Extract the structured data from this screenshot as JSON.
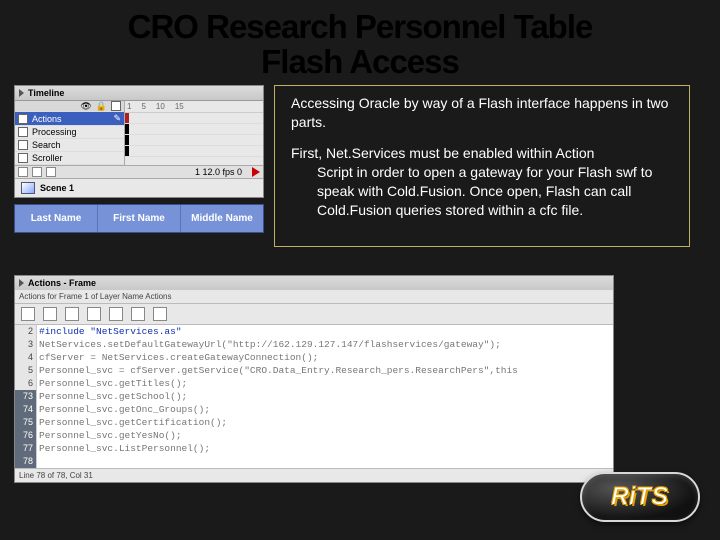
{
  "title_line1": "CRO Research Personnel Table",
  "title_line2": "Flash Access",
  "timeline": {
    "header": "Timeline",
    "ruler": [
      "1",
      "5",
      "10",
      "15"
    ],
    "layers": [
      "Actions",
      "Processing",
      "Search",
      "Scroller"
    ],
    "footer_status": "1   12.0 fps   0",
    "scene": "Scene 1"
  },
  "table_headers": [
    "Last Name",
    "First Name",
    "Middle Name"
  ],
  "body": {
    "p1": "Accessing Oracle by way of a Flash interface happens in two parts.",
    "p2a": "First, Net.Services must be enabled within Action",
    "p2b": "Script in order to open a gateway for your Flash swf to speak with Cold.Fusion. Once open, Flash can call Cold.Fusion queries stored within a cfc file."
  },
  "actions": {
    "header": "Actions - Frame",
    "sub": "Actions for Frame 1 of Layer Name Actions",
    "gutter": [
      "2",
      "3",
      "4",
      "5",
      "6",
      "73",
      "74",
      "75",
      "76",
      "77",
      "78"
    ],
    "code": [
      {
        "cls": "blue",
        "t": "#include \"NetServices.as\""
      },
      {
        "cls": "gray",
        "t": ""
      },
      {
        "cls": "gray",
        "t": "NetServices.setDefaultGatewayUrl(\"http://162.129.127.147/flashservices/gateway\");"
      },
      {
        "cls": "gray",
        "t": "cfServer = NetServices.createGatewayConnection();"
      },
      {
        "cls": "gray",
        "t": "Personnel_svc = cfServer.getService(\"CRO.Data_Entry.Research_pers.ResearchPers\",this"
      },
      {
        "cls": "gray",
        "t": "Personnel_svc.getTitles();"
      },
      {
        "cls": "gray",
        "t": "Personnel_svc.getSchool();"
      },
      {
        "cls": "gray",
        "t": "Personnel_svc.getOnc_Groups();"
      },
      {
        "cls": "gray",
        "t": "Personnel_svc.getCertification();"
      },
      {
        "cls": "gray",
        "t": "Personnel_svc.getYesNo();"
      },
      {
        "cls": "gray",
        "t": "Personnel_svc.ListPersonnel();"
      }
    ],
    "status": "Line 78 of 78, Col 31"
  },
  "logo": "RiTS"
}
